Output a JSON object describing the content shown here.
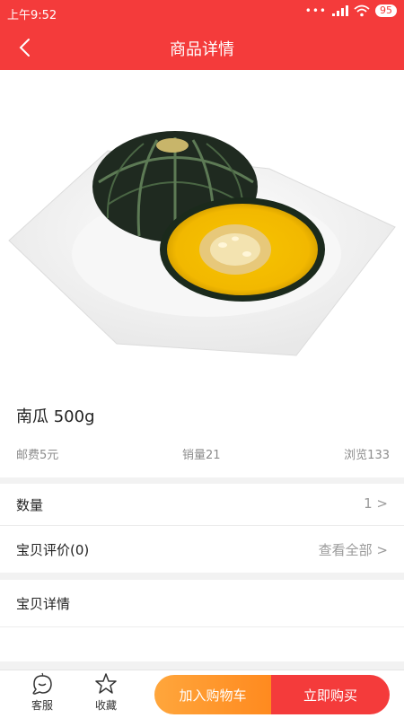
{
  "status_bar": {
    "time": "上午9:52",
    "battery": "95"
  },
  "header": {
    "title": "商品详情"
  },
  "product": {
    "name": "南瓜 500g",
    "shipping": "邮费5元",
    "sales": "销量21",
    "views": "浏览133",
    "image_icon": "pumpkin-image"
  },
  "quantity": {
    "label": "数量",
    "value": "1 >"
  },
  "reviews": {
    "label": "宝贝评价(0)",
    "link": "查看全部 >"
  },
  "details": {
    "label": "宝贝详情"
  },
  "bottom_bar": {
    "service_label": "客服",
    "favorite_label": "收藏",
    "cart_label": "加入购物车",
    "buy_label": "立即购买"
  },
  "colors": {
    "primary": "#f43b3b",
    "cart": "#ff9a2e",
    "background": "#f2f2f2"
  }
}
